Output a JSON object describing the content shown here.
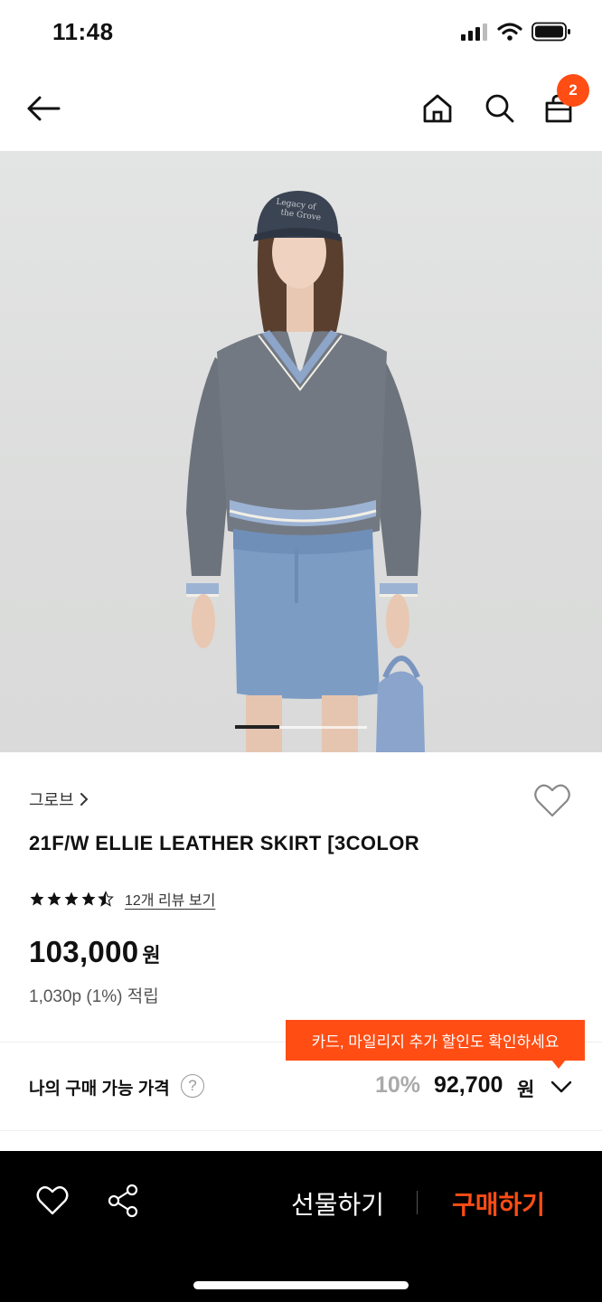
{
  "status_bar": {
    "time": "11:48"
  },
  "nav": {
    "back_icon": "arrow-left-icon",
    "home_icon": "home-icon",
    "search_icon": "search-icon",
    "cart_icon": "shopping-bag-icon",
    "cart_count": "2"
  },
  "product": {
    "image_pager": {
      "total": 3,
      "active": 1
    },
    "brand": "그로브",
    "title": "21F/W ELLIE LEATHER SKIRT [3COLOR",
    "rating": 4.5,
    "review_link": "12개 리뷰 보기",
    "price": "103,000",
    "price_unit": "원",
    "points": "1,030p (1%) 적립"
  },
  "discount": {
    "tooltip": "카드, 마일리지 추가 할인도 확인하세요",
    "label": "나의 구매 가능 가격",
    "help": "?",
    "rate": "10%",
    "price": "92,700",
    "unit": "원"
  },
  "bottom_bar": {
    "gift_label": "선물하기",
    "buy_label": "구매하기"
  },
  "colors": {
    "accent": "#ff4d14",
    "text": "#111111",
    "muted": "#aaaaaa",
    "bottom_bar": "#000000"
  }
}
